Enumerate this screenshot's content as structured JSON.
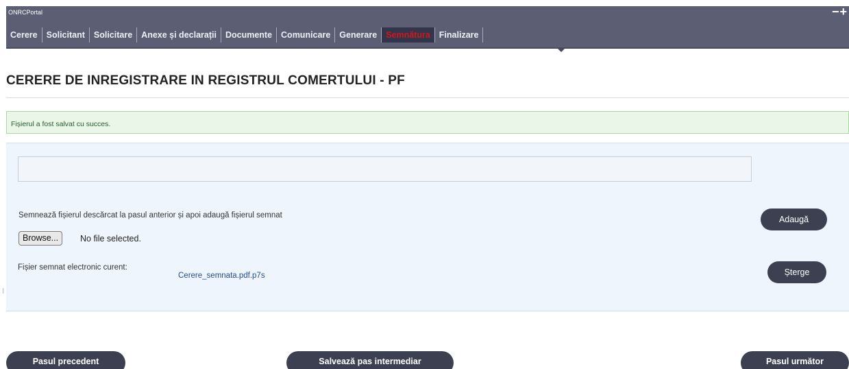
{
  "portal": {
    "title": "ONRCPortal",
    "controls": "−+"
  },
  "nav": {
    "tabs": [
      {
        "label": "Cerere",
        "active": false
      },
      {
        "label": "Solicitant",
        "active": false
      },
      {
        "label": "Solicitare",
        "active": false
      },
      {
        "label": "Anexe și declarații",
        "active": false
      },
      {
        "label": "Documente",
        "active": false
      },
      {
        "label": "Comunicare",
        "active": false
      },
      {
        "label": "Generare",
        "active": false
      },
      {
        "label": "Semnătura",
        "active": true
      },
      {
        "label": "Finalizare",
        "active": false
      }
    ]
  },
  "page": {
    "title": "CERERE DE INREGISTRARE IN REGISTRUL COMERTULUI - PF"
  },
  "message": {
    "success": "Fișierul a fost salvat cu succes."
  },
  "upload": {
    "filename_value": "",
    "instruction": "Semnează fișierul descărcat la pasul anterior și apoi adaugă fișierul semnat",
    "browse_label": "Browse...",
    "no_file_text": "No file selected.",
    "add_label": "Adaugă",
    "current_label": "Fișier semnat electronic curent:",
    "current_file": "Cerere_semnata.pdf.p7s",
    "delete_label": "Șterge"
  },
  "footer": {
    "prev_label": "Pasul precedent",
    "save_label": "Salvează pas intermediar",
    "next_label": "Pasul următor"
  },
  "colors": {
    "header_bg": "#5c5f74",
    "active_tab_text": "#d3161a",
    "button_bg": "#3d4050",
    "success_bg": "#eaf6e7",
    "panel_bg": "#eef5fc"
  }
}
